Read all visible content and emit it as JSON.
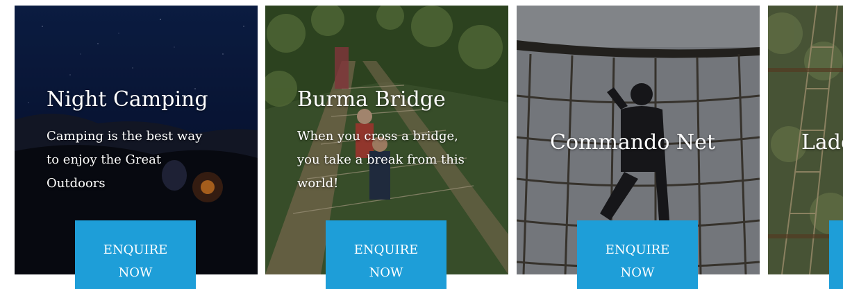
{
  "cards": [
    {
      "title": "Night Camping",
      "description_lines": [
        "Camping is the best way",
        "to enjoy the Great",
        "Outdoors"
      ],
      "button_line1": "ENQUIRE",
      "button_line2": "NOW",
      "image": "night-sky-camp-photo"
    },
    {
      "title": "Burma Bridge",
      "description_lines": [
        "When you cross a bridge,",
        "you take a break from this",
        "world!"
      ],
      "button_line1": "ENQUIRE",
      "button_line2": "NOW",
      "image": "rope-bridge-forest-photo"
    },
    {
      "title": "Commando Net",
      "button_line1": "ENQUIRE",
      "button_line2": "NOW",
      "image": "climbing-net-photo"
    },
    {
      "title": "Ladd",
      "image": "rope-ladder-trees-photo"
    }
  ],
  "colors": {
    "button": "#1e9ed8",
    "text": "#ffffff"
  }
}
